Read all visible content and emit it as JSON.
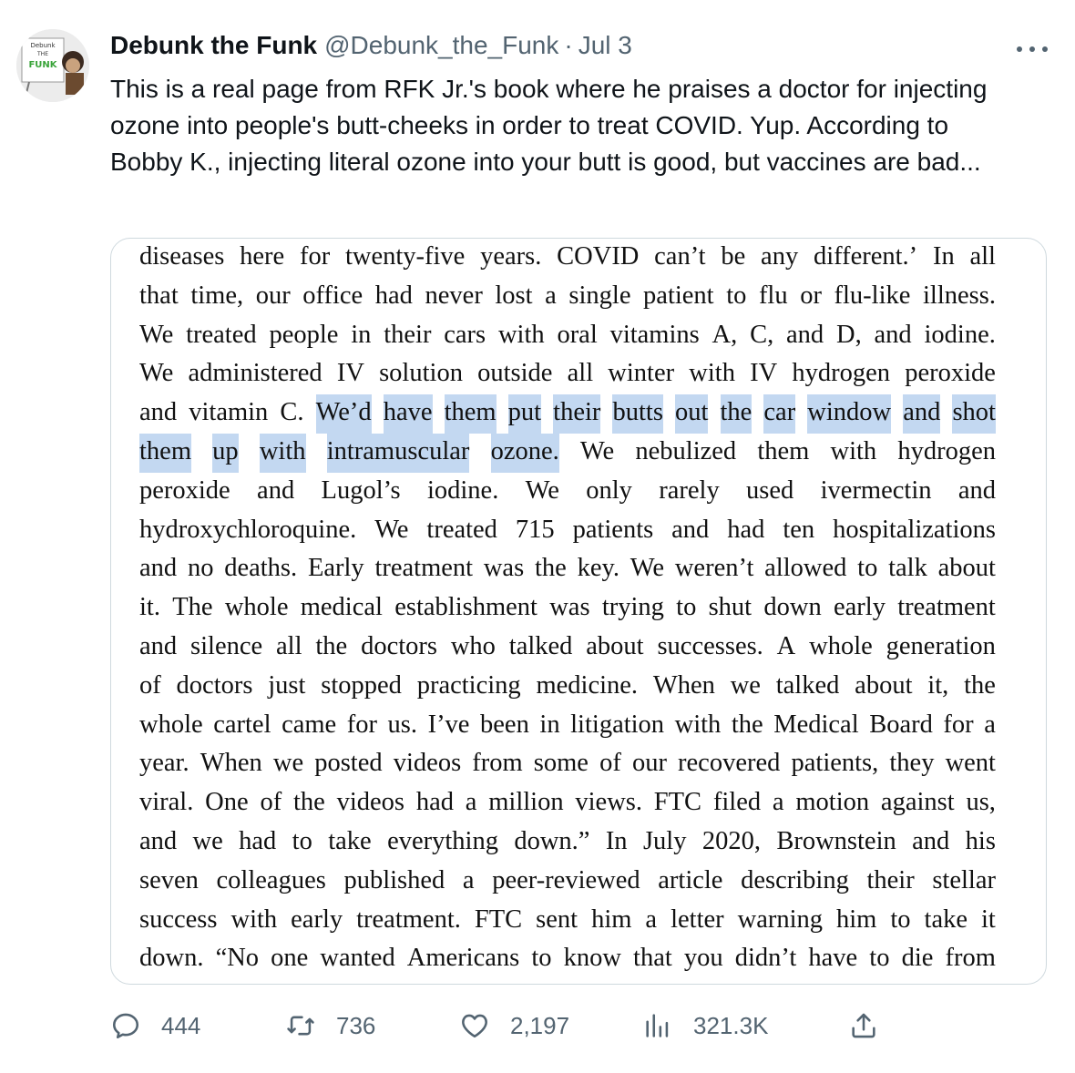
{
  "author": {
    "display_name": "Debunk the Funk",
    "handle": "@Debunk_the_Funk",
    "separator": "·",
    "date": "Jul 3",
    "avatar_sign_lines": [
      "Debunk",
      "THE",
      "FUNK"
    ]
  },
  "tweet": {
    "text": "This is a real page from RFK Jr.'s book where he praises a doctor for injecting ozone into people's butt-cheeks in order to treat COVID. Yup. According to Bobby K., injecting literal ozone into your butt is good, but vaccines are bad..."
  },
  "book_page": {
    "lines": [
      "diseases here for twenty-five years. COVID can’t be any different.’ In all",
      "that time, our office had never lost a single patient to flu or flu-like illness.",
      "We treated people in their cars with oral vitamins A, C, and D, and iodine.",
      "We administered IV solution outside all winter with IV hydrogen peroxide",
      "and vitamin C. We’d have them put their butts out the car window and shot",
      "them up with intramuscular ozone. We nebulized them with hydrogen",
      "peroxide and Lugol’s iodine. We only rarely used ivermectin and",
      "hydroxychloroquine. We treated 715 patients and had ten hospitalizations",
      "and no deaths. Early treatment was the key. We weren’t allowed to talk about",
      "it. The whole medical establishment was trying to shut down early treatment",
      "and silence all the doctors who talked about successes. A whole generation",
      "of doctors just stopped practicing medicine. When we talked about it, the",
      "whole cartel came for us. I’ve been in litigation with the Medical Board for a",
      "year. When we posted videos from some of our recovered patients, they went",
      "viral. One of the videos had a million views. FTC filed a motion against us,",
      "and we had to take everything down.” In July 2020, Brownstein and his",
      "seven colleagues published a peer-reviewed article describing their stellar",
      "success with early treatment. FTC sent him a letter warning him to take it",
      "down. “No one wanted Americans to know that you didn’t have to die from"
    ],
    "highlighted_text": "We’d have them put their butts out the car window and shot them up with intramuscular ozone.",
    "highlight_color": "#c3d8f1"
  },
  "actions": {
    "replies": "444",
    "retweets": "736",
    "likes": "2,197",
    "views": "321.3K"
  },
  "colors": {
    "text": "#0f1419",
    "secondary": "#536471",
    "border": "#cfd9de"
  },
  "icons": {
    "reply": "reply-icon",
    "retweet": "retweet-icon",
    "like": "heart-icon",
    "views": "views-icon",
    "share": "share-icon",
    "more": "more-icon"
  }
}
